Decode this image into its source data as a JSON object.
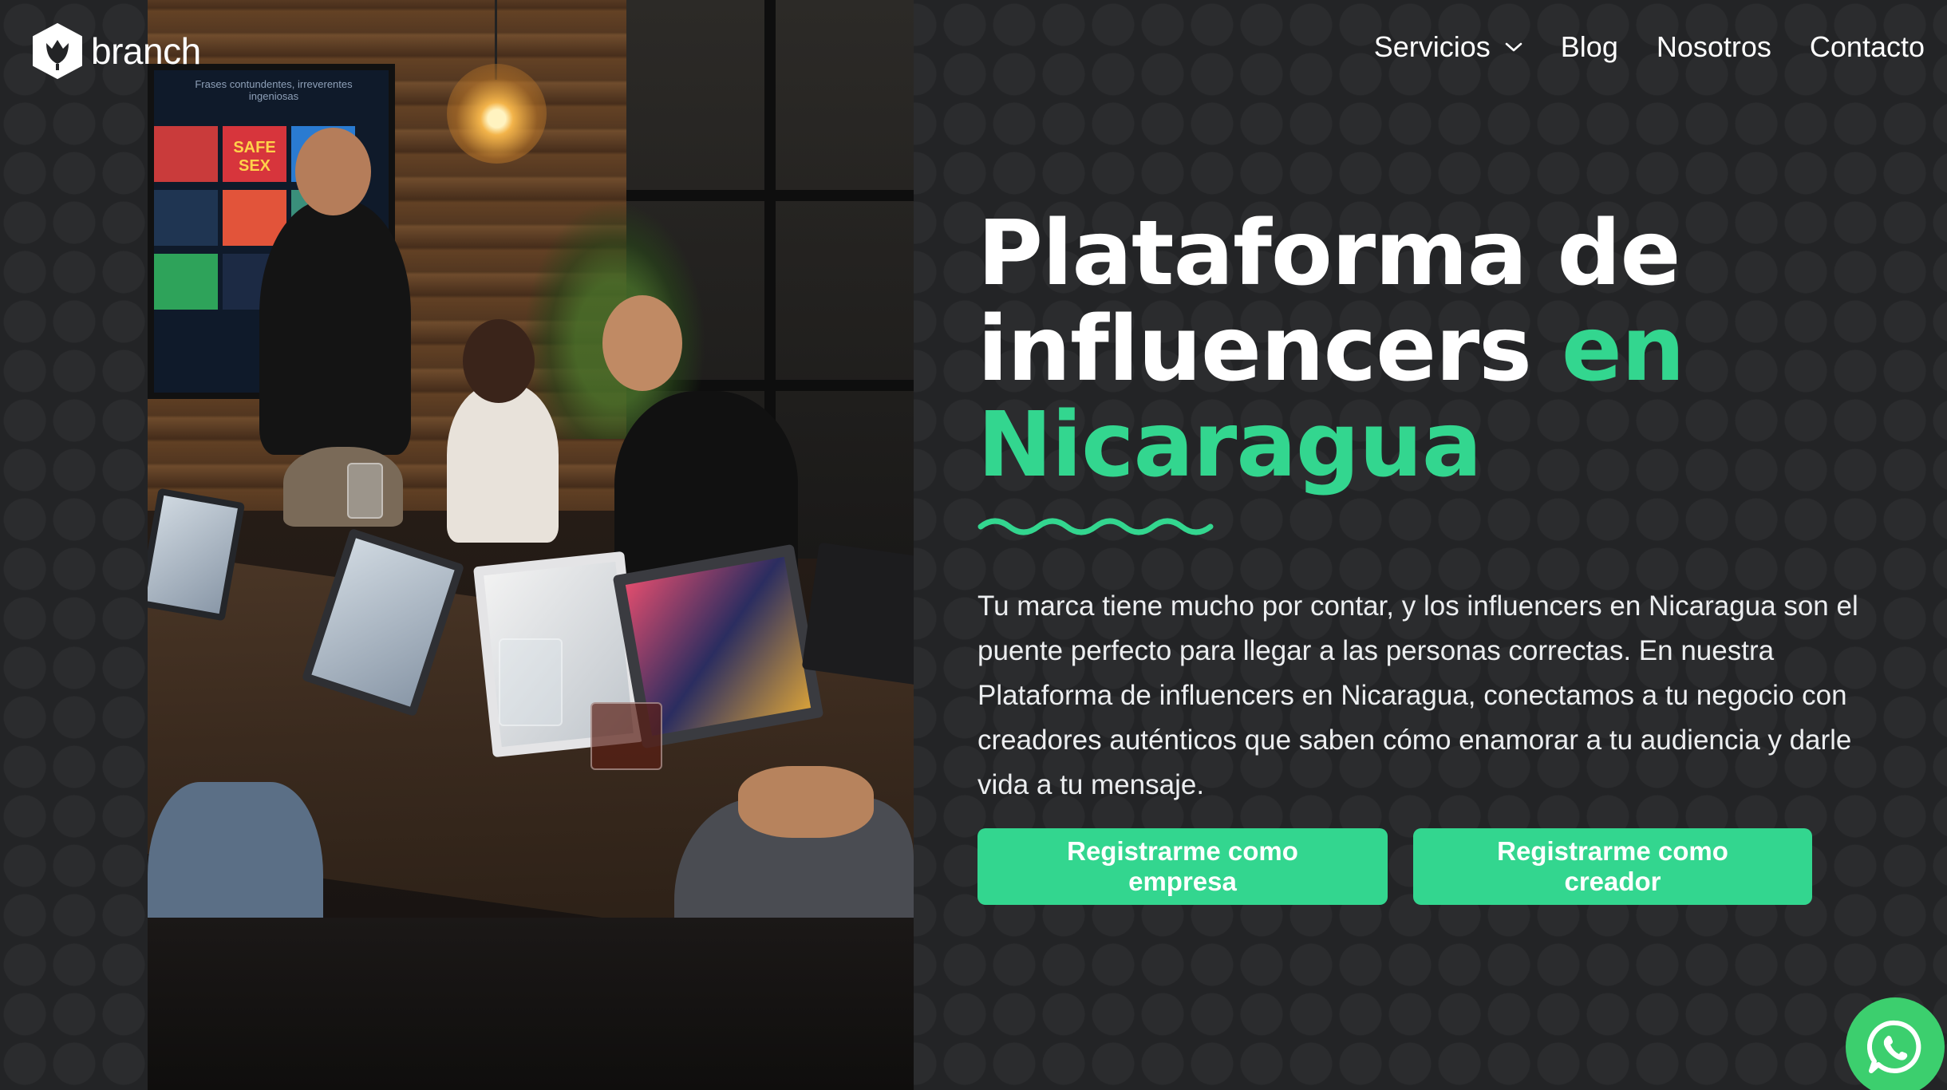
{
  "brand": {
    "name": "branch",
    "logo_icon": "tulip-shield-icon"
  },
  "nav": {
    "items": [
      {
        "label": "Servicios",
        "has_dropdown": true
      },
      {
        "label": "Blog"
      },
      {
        "label": "Nosotros"
      },
      {
        "label": "Contacto"
      }
    ]
  },
  "hero": {
    "title_line1": "Plataforma de",
    "title_line2_plain": "influencers ",
    "title_line2_highlight": "en",
    "title_line3_highlight": "Nicaragua",
    "description": "Tu marca tiene mucho por contar, y los influencers en Nicaragua son el puente perfecto para llegar a las personas correctas. En nuestra Plataforma de influencers en Nicaragua, conectamos a tu negocio con creadores auténticos que saben cómo enamorar a tu audiencia y darle vida a tu mensaje.",
    "cta_company": "Registrarme como empresa",
    "cta_creator": "Registrarme como creador"
  },
  "photo": {
    "tv_text_1": "Frases contundentes, irreverentes",
    "tv_text_2": "ingeniosas",
    "tv_badge": "SAFE SEX"
  },
  "colors": {
    "accent": "#33d68f",
    "background": "#232426",
    "whatsapp": "#3ccf6e"
  },
  "floating": {
    "whatsapp_icon": "whatsapp-icon"
  }
}
